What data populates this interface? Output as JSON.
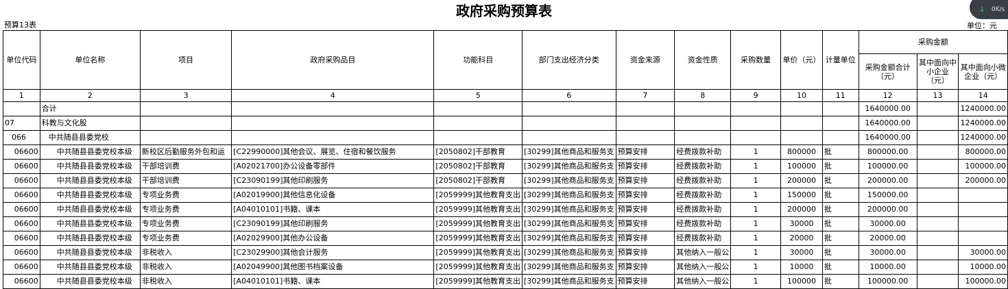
{
  "title": "政府采购预算表",
  "table_no": "预算13表",
  "unit_label": "单位：元",
  "overlay": {
    "arrow": "↓",
    "speed": "0K/s"
  },
  "headers": {
    "unit_code": "单位代码",
    "unit_name": "单位名称",
    "project": "项目",
    "procurement_item": "政府采购品目",
    "function_subject": "功能科目",
    "economic_class": "部门支出经济分类",
    "fund_source": "资金来源",
    "fund_nature": "资金性质",
    "quantity": "采购数量",
    "unit_price": "单价（元）",
    "measure_unit": "计量单位",
    "amount_group": "采购金额",
    "amount_total": "采购金额合计（元）",
    "sme": "其中面向中小企业（元）",
    "micro": "其中面向小微企业（元）"
  },
  "column_numbers": [
    "1",
    "2",
    "3",
    "4",
    "5",
    "6",
    "7",
    "8",
    "9",
    "10",
    "11",
    "12",
    "13",
    "14"
  ],
  "summary_rows": [
    {
      "code": "",
      "name": "合计",
      "total": "1640000.00",
      "micro": "1240000.00",
      "indent": 0
    },
    {
      "code": "07",
      "name": "科教与文化股",
      "total": "1640000.00",
      "micro": "1240000.00",
      "indent": 0
    },
    {
      "code": "066",
      "name": "中共随县县委党校",
      "total": "1640000.00",
      "micro": "1240000.00",
      "indent": 1
    }
  ],
  "rows": [
    {
      "code": "06600",
      "name": "中共随县县委党校本级",
      "project": "新校区后勤服务外包和运",
      "item": "[C22990000]其他会议、展览、住宿和餐饮服务",
      "func": "[2050802]干部教育",
      "econ": "[30299]其他商品和服务支",
      "source": "预算安排",
      "nature": "经费拨款补助",
      "qty": "1",
      "price": "800000",
      "unit": "批",
      "total": "800000.00",
      "sme": "",
      "micro": "800000.00"
    },
    {
      "code": "06600",
      "name": "中共随县县委党校本级",
      "project": "干部培训费",
      "item": "[A02021700]办公设备零部件",
      "func": "[2050802]干部教育",
      "econ": "[30299]其他商品和服务支",
      "source": "预算安排",
      "nature": "经费拨款补助",
      "qty": "1",
      "price": "100000",
      "unit": "批",
      "total": "100000.00",
      "sme": "",
      "micro": "100000.00"
    },
    {
      "code": "06600",
      "name": "中共随县县委党校本级",
      "project": "干部培训费",
      "item": "[C23090199]其他印刷服务",
      "func": "[2050802]干部教育",
      "econ": "[30299]其他商品和服务支",
      "source": "预算安排",
      "nature": "经费拨款补助",
      "qty": "1",
      "price": "200000",
      "unit": "批",
      "total": "200000.00",
      "sme": "",
      "micro": "200000.00"
    },
    {
      "code": "06600",
      "name": "中共随县县委党校本级",
      "project": "专项业务费",
      "item": "[A02019900]其他信息化设备",
      "func": "[2059999]其他教育支出",
      "econ": "[30299]其他商品和服务支",
      "source": "预算安排",
      "nature": "经费拨款补助",
      "qty": "1",
      "price": "150000",
      "unit": "批",
      "total": "150000.00",
      "sme": "",
      "micro": ""
    },
    {
      "code": "06600",
      "name": "中共随县县委党校本级",
      "project": "专项业务费",
      "item": "[A04010101]书籍、课本",
      "func": "[2059999]其他教育支出",
      "econ": "[30299]其他商品和服务支",
      "source": "预算安排",
      "nature": "经费拨款补助",
      "qty": "1",
      "price": "200000",
      "unit": "批",
      "total": "200000.00",
      "sme": "",
      "micro": ""
    },
    {
      "code": "06600",
      "name": "中共随县县委党校本级",
      "project": "专项业务费",
      "item": "[C23090199]其他印刷服务",
      "func": "[2059999]其他教育支出",
      "econ": "[30299]其他商品和服务支",
      "source": "预算安排",
      "nature": "经费拨款补助",
      "qty": "1",
      "price": "30000",
      "unit": "批",
      "total": "30000.00",
      "sme": "",
      "micro": ""
    },
    {
      "code": "06600",
      "name": "中共随县县委党校本级",
      "project": "专项业务费",
      "item": "[A02029900]其他办公设备",
      "func": "[2059999]其他教育支出",
      "econ": "[30299]其他商品和服务支",
      "source": "预算安排",
      "nature": "经费拨款补助",
      "qty": "1",
      "price": "20000",
      "unit": "批",
      "total": "20000.00",
      "sme": "",
      "micro": ""
    },
    {
      "code": "06600",
      "name": "中共随县县委党校本级",
      "project": "非税收入",
      "item": "[C23029900]其他会计服务",
      "func": "[2059999]其他教育支出",
      "econ": "[30299]其他商品和服务支",
      "source": "预算安排",
      "nature": "其他纳入一般公",
      "qty": "1",
      "price": "30000",
      "unit": "批",
      "total": "30000.00",
      "sme": "",
      "micro": "30000.00"
    },
    {
      "code": "06600",
      "name": "中共随县县委党校本级",
      "project": "非税收入",
      "item": "[A02049900]其他图书档案设备",
      "func": "[2059999]其他教育支出",
      "econ": "[30299]其他商品和服务支",
      "source": "预算安排",
      "nature": "其他纳入一般公",
      "qty": "1",
      "price": "10000",
      "unit": "批",
      "total": "10000.00",
      "sme": "",
      "micro": "10000.00"
    },
    {
      "code": "06600",
      "name": "中共随县县委党校本级",
      "project": "非税收入",
      "item": "[A04010101]书籍、课本",
      "func": "[2059999]其他教育支出",
      "econ": "[30299]其他商品和服务支",
      "source": "预算安排",
      "nature": "其他纳入一般公",
      "qty": "1",
      "price": "100000",
      "unit": "批",
      "total": "100000.00",
      "sme": "",
      "micro": "100000.00"
    }
  ]
}
